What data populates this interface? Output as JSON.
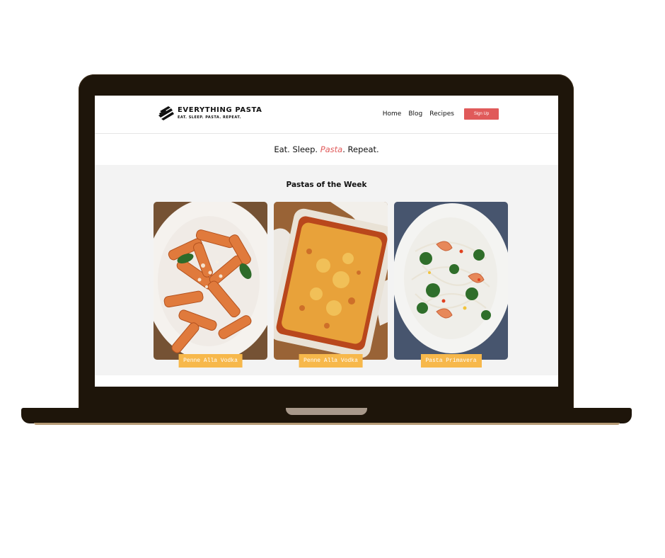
{
  "site": {
    "brand_name": "EVERYTHING PASTA",
    "brand_tagline": "EAT. SLEEP. PASTA. REPEAT.",
    "nav": [
      "Home",
      "Blog",
      "Recipes"
    ],
    "signup_label": "Sign Up"
  },
  "tagline": {
    "part1": "Eat. Sleep.",
    "accent": "Pasta",
    "part2": ". Repeat."
  },
  "section": {
    "title": "Pastas of the Week",
    "cards": [
      {
        "label": "Penne Alla Vodka",
        "image": "penne-pasta-plate"
      },
      {
        "label": "Penne Alla Vodka",
        "image": "baked-casserole"
      },
      {
        "label": "Pasta Primavera",
        "image": "shrimp-primavera-plate"
      }
    ]
  },
  "colors": {
    "accent": "#e05a5a",
    "label_bg": "#f7b84b",
    "laptop_frame": "#1e150a",
    "section_bg": "#f3f3f3"
  }
}
